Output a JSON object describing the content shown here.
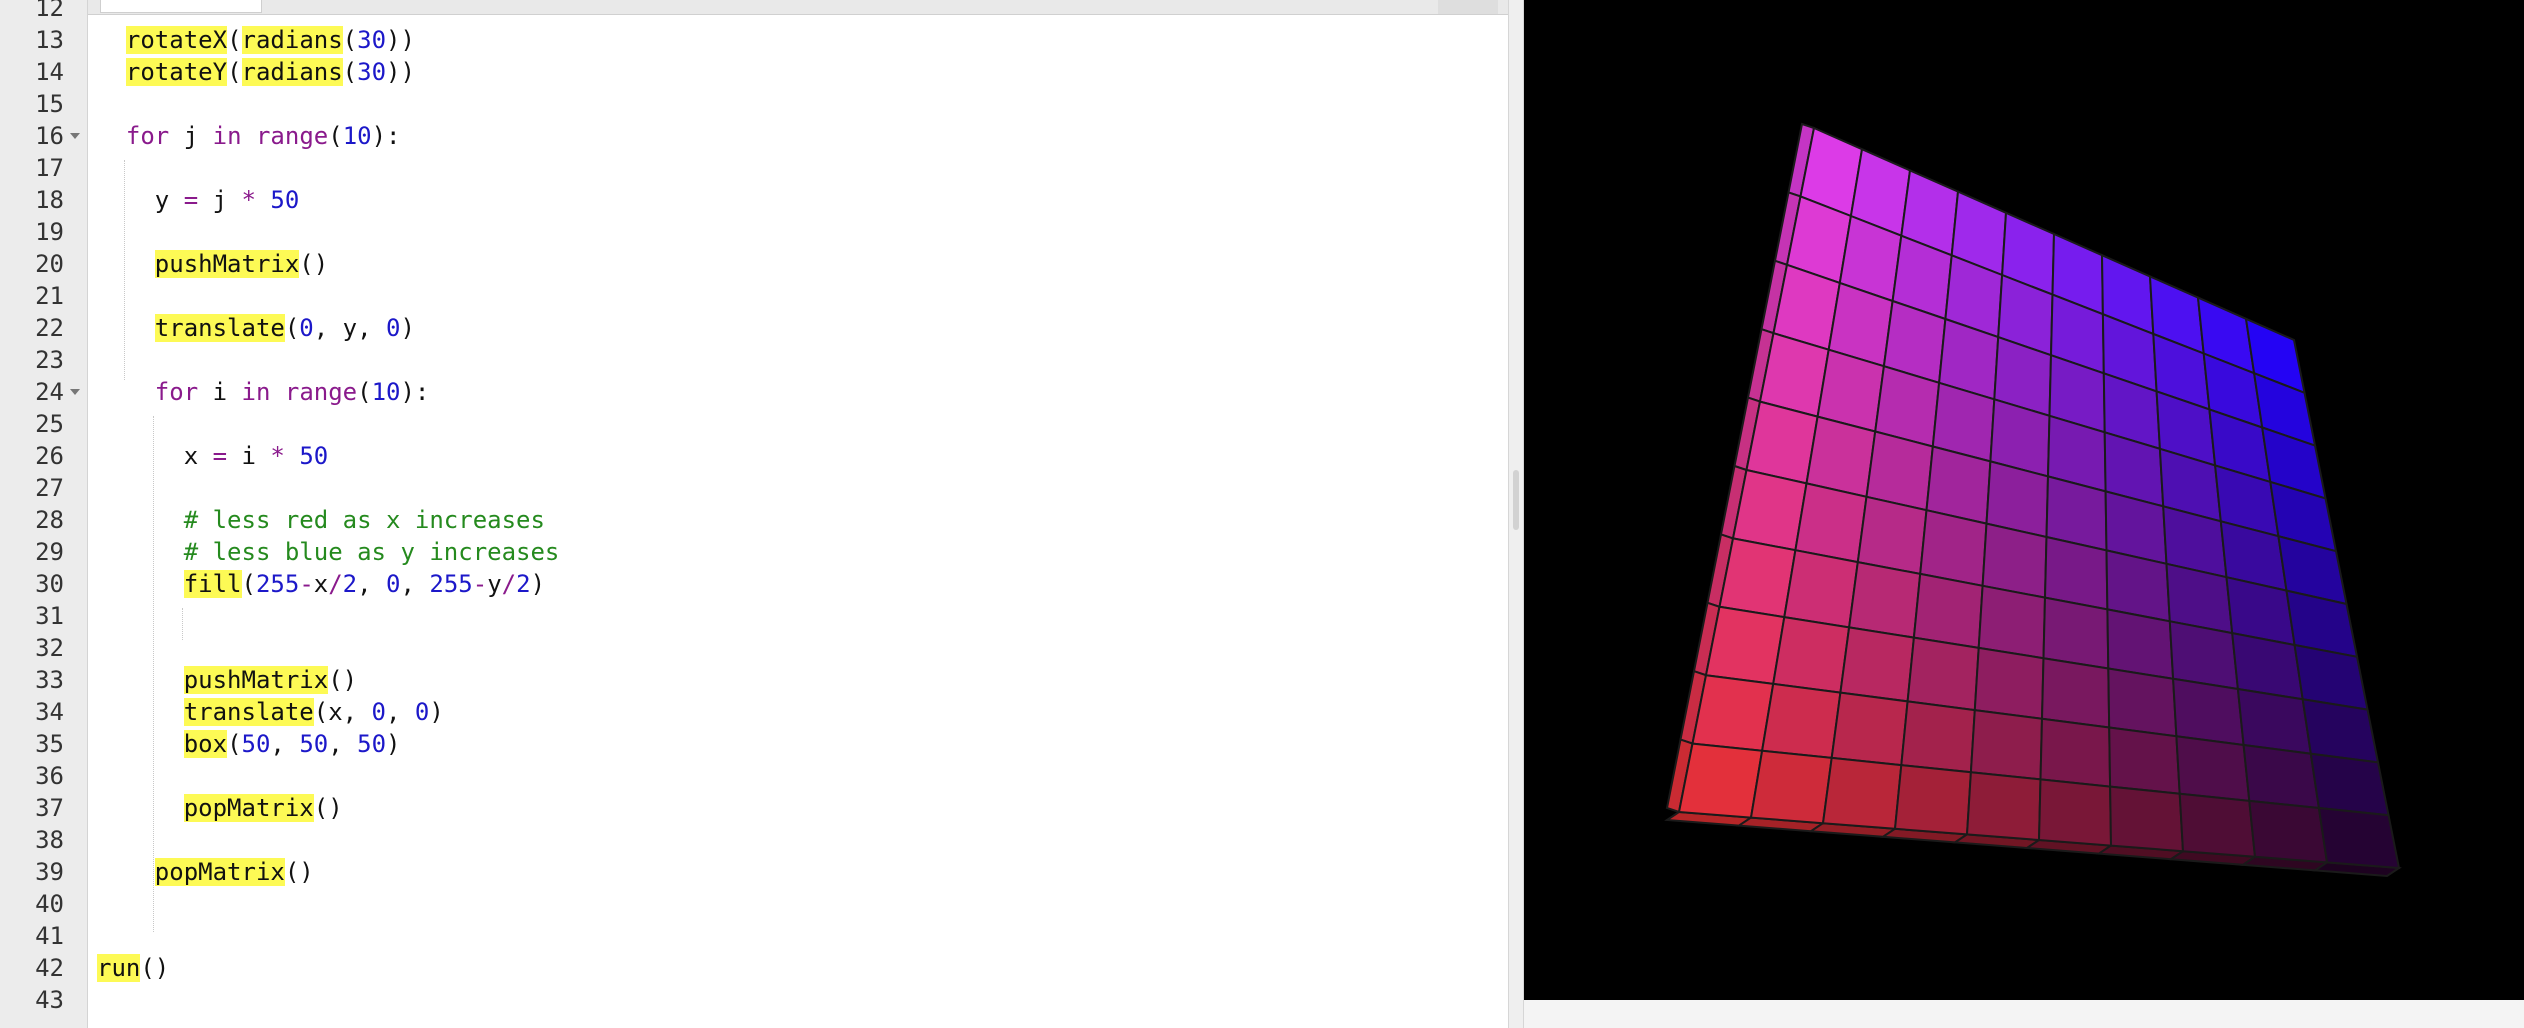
{
  "editor": {
    "lines": [
      {
        "n": "12",
        "html": ""
      },
      {
        "n": "13",
        "html": "  <span class=\"hl\">rotateX</span>(<span class=\"hl\">radians</span>(<span class=\"num\">30</span>))"
      },
      {
        "n": "14",
        "html": "  <span class=\"hl\">rotateY</span>(<span class=\"hl\">radians</span>(<span class=\"num\">30</span>))"
      },
      {
        "n": "15",
        "html": ""
      },
      {
        "n": "16",
        "fold": true,
        "html": "  <span class=\"kw\">for</span> j <span class=\"kw\">in</span> <span class=\"kw\">range</span>(<span class=\"num\">10</span>):"
      },
      {
        "n": "17",
        "html": ""
      },
      {
        "n": "18",
        "html": "    y <span class=\"op\">=</span> j <span class=\"op\">*</span> <span class=\"num\">50</span>"
      },
      {
        "n": "19",
        "html": ""
      },
      {
        "n": "20",
        "html": "    <span class=\"hl\">pushMatrix</span>()"
      },
      {
        "n": "21",
        "html": ""
      },
      {
        "n": "22",
        "html": "    <span class=\"hl\">translate</span>(<span class=\"num\">0</span>, y, <span class=\"num\">0</span>)"
      },
      {
        "n": "23",
        "html": ""
      },
      {
        "n": "24",
        "fold": true,
        "html": "    <span class=\"kw\">for</span> i <span class=\"kw\">in</span> <span class=\"kw\">range</span>(<span class=\"num\">10</span>):"
      },
      {
        "n": "25",
        "html": ""
      },
      {
        "n": "26",
        "html": "      x <span class=\"op\">=</span> i <span class=\"op\">*</span> <span class=\"num\">50</span>"
      },
      {
        "n": "27",
        "html": ""
      },
      {
        "n": "28",
        "html": "      <span class=\"cm\"># less red as x increases</span>"
      },
      {
        "n": "29",
        "html": "      <span class=\"cm\"># less blue as y increases</span>"
      },
      {
        "n": "30",
        "html": "      <span class=\"hl\">fill</span>(<span class=\"num\">255</span><span class=\"op\">-</span>x<span class=\"op\">/</span><span class=\"num\">2</span>, <span class=\"num\">0</span>, <span class=\"num\">255</span><span class=\"op\">-</span>y<span class=\"op\">/</span><span class=\"num\">2</span>)"
      },
      {
        "n": "31",
        "html": ""
      },
      {
        "n": "32",
        "html": ""
      },
      {
        "n": "33",
        "html": "      <span class=\"hl\">pushMatrix</span>()"
      },
      {
        "n": "34",
        "html": "      <span class=\"hl\">translate</span>(x, <span class=\"num\">0</span>, <span class=\"num\">0</span>)"
      },
      {
        "n": "35",
        "html": "      <span class=\"hl\">box</span>(<span class=\"num\">50</span>, <span class=\"num\">50</span>, <span class=\"num\">50</span>)"
      },
      {
        "n": "36",
        "html": ""
      },
      {
        "n": "37",
        "html": "      <span class=\"hl\">popMatrix</span>()"
      },
      {
        "n": "38",
        "html": ""
      },
      {
        "n": "39",
        "html": "    <span class=\"hl\">popMatrix</span>()"
      },
      {
        "n": "40",
        "html": ""
      },
      {
        "n": "41",
        "html": ""
      },
      {
        "n": "42",
        "html": "<span class=\"hl\">run</span>()"
      },
      {
        "n": "43",
        "html": ""
      }
    ]
  },
  "sketch": {
    "grid_cells": 10,
    "colors": {
      "top_left": "#e63ff0",
      "top_right": "#1a00ff",
      "bottom_left": "#ee3232",
      "bottom_right": "#1a0028",
      "background": "#000000",
      "stroke": "#1a1a1a"
    }
  }
}
